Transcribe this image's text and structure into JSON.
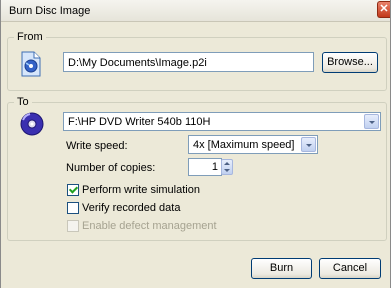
{
  "window": {
    "title": "Burn Disc Image",
    "close_glyph": "✕"
  },
  "from": {
    "label": "From",
    "icon": "disc-image-file-icon",
    "path": "D:\\My Documents\\Image.p2i",
    "browse_label": "Browse..."
  },
  "to": {
    "label": "To",
    "icon": "cd-disc-icon",
    "drive": "F:\\HP DVD Writer 540b 110H",
    "write_speed_label": "Write speed:",
    "write_speed_value": "4x [Maximum speed]",
    "copies_label": "Number of copies:",
    "copies_value": "1",
    "options": [
      {
        "label": "Perform write simulation",
        "checked": true,
        "enabled": true
      },
      {
        "label": "Verify recorded data",
        "checked": false,
        "enabled": true
      },
      {
        "label": "Enable defect management",
        "checked": false,
        "enabled": false
      }
    ]
  },
  "buttons": {
    "burn": "Burn",
    "cancel": "Cancel"
  }
}
